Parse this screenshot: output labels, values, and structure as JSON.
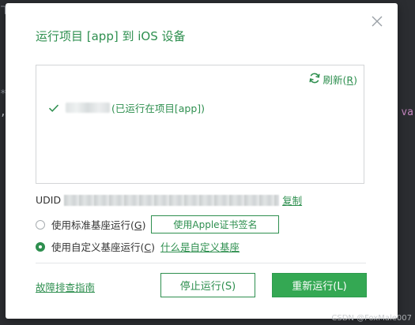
{
  "background": {
    "fragment_left_1": "ㄒ",
    "fragment_left_2": "*",
    "fragment_left_3": ",",
    "fragment_right_1": "; va"
  },
  "dialog": {
    "title": "运行项目 [app] 到 iOS 设备",
    "close_icon": "close-icon",
    "device_panel": {
      "refresh_label": "刷新(",
      "refresh_key": "R",
      "refresh_close": ")",
      "devices": [
        {
          "status": "(已运行在项目[app])"
        }
      ]
    },
    "udid_label": "UDID",
    "copy_link": "复制",
    "options": {
      "standard_label": "使用标准基座运行(",
      "standard_key": "G",
      "standard_close": ")",
      "apple_sign_button": "使用Apple证书签名",
      "custom_label": "使用自定义基座运行(",
      "custom_key": "C",
      "custom_close": ")",
      "custom_help_link": "什么是自定义基座",
      "selected": "custom"
    },
    "footer": {
      "help_link": "故障排查指南",
      "stop_button": "停止运行(S)",
      "rerun_button": "重新运行(L)"
    }
  },
  "watermark": "CSDN @FoxMale007",
  "colors": {
    "accent": "#2e8f4f",
    "primary_button": "#34a853",
    "border": "#d3d5d7"
  }
}
